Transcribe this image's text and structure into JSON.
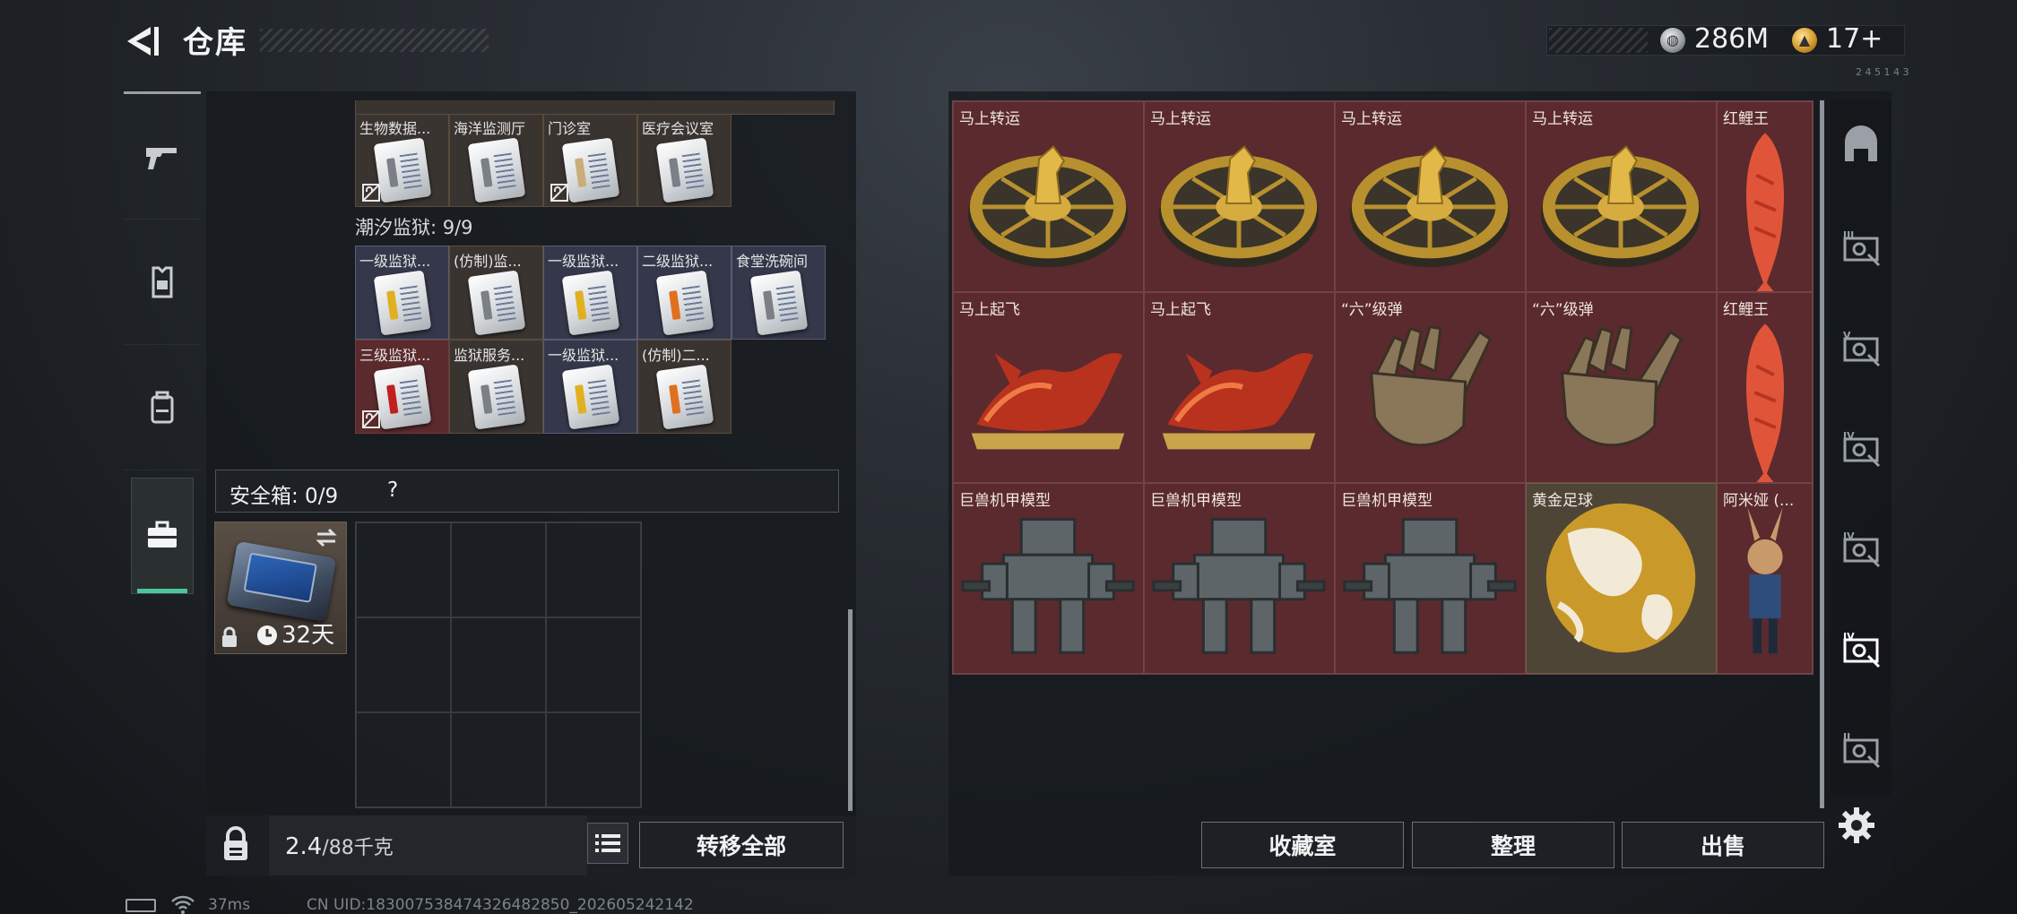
{
  "header": {
    "title": "仓库",
    "currencies": [
      {
        "icon": "silver-coin-icon",
        "value": "286M"
      },
      {
        "icon": "gold-coin-icon",
        "value": "17+"
      }
    ],
    "version_tag": "2 4 5 1 4 3"
  },
  "left_rail": [
    {
      "icon": "pistol-icon",
      "active": false
    },
    {
      "icon": "armor-vest-icon",
      "active": false
    },
    {
      "icon": "backpack-icon",
      "active": false
    },
    {
      "icon": "briefcase-icon",
      "active": true
    }
  ],
  "storage": {
    "row_top": [
      {
        "label": "生物数据...",
        "stripe": "#7b7f86",
        "locked": true
      },
      {
        "label": "海洋监测厅",
        "stripe": "#7b7f86",
        "locked": false
      },
      {
        "label": "门诊室",
        "stripe": "#c9ad7a",
        "locked": true
      },
      {
        "label": "医疗会议室",
        "stripe": "#7b7f86",
        "locked": false
      }
    ],
    "section_title": "潮汐监狱: 9/9",
    "section_cards": [
      {
        "label": "一级监狱...",
        "stripe": "#e0b020",
        "locked": false,
        "tone": "blue"
      },
      {
        "label": "(仿制)监...",
        "stripe": "#7b7f86",
        "locked": false,
        "tone": "brown"
      },
      {
        "label": "一级监狱...",
        "stripe": "#e0b020",
        "locked": false,
        "tone": "blue"
      },
      {
        "label": "二级监狱...",
        "stripe": "#e07020",
        "locked": false,
        "tone": "blue"
      },
      {
        "label": "食堂洗碗间",
        "stripe": "#7b7f86",
        "locked": false,
        "tone": "blue"
      },
      {
        "label": "三级监狱...",
        "stripe": "#c02020",
        "locked": true,
        "tone": "red"
      },
      {
        "label": "监狱服务...",
        "stripe": "#7b7f86",
        "locked": false,
        "tone": "brown"
      },
      {
        "label": "一级监狱...",
        "stripe": "#e0b020",
        "locked": false,
        "tone": "blue"
      },
      {
        "label": "(仿制)二...",
        "stripe": "#e07020",
        "locked": false,
        "tone": "brown"
      }
    ]
  },
  "safe_box": {
    "title": "安全箱: 0/9",
    "help": "?",
    "days": "32天"
  },
  "footer_left": {
    "weight": "2.4",
    "weight_unit": "/88千克",
    "transfer_all": "转移全部"
  },
  "items": [
    {
      "label": "马上转运",
      "kind": "compass",
      "tone": "red"
    },
    {
      "label": "马上转运",
      "kind": "compass",
      "tone": "red"
    },
    {
      "label": "马上转运",
      "kind": "compass",
      "tone": "red"
    },
    {
      "label": "马上转运",
      "kind": "compass",
      "tone": "red"
    },
    {
      "label": "红鲤王",
      "kind": "fish",
      "tone": "red"
    },
    {
      "label": "马上起飞",
      "kind": "horse",
      "tone": "red"
    },
    {
      "label": "马上起飞",
      "kind": "horse",
      "tone": "red"
    },
    {
      "label": "“六”级弹",
      "kind": "hand",
      "tone": "red"
    },
    {
      "label": "“六”级弹",
      "kind": "hand",
      "tone": "red"
    },
    {
      "label": "红鲤王",
      "kind": "fish",
      "tone": "red"
    },
    {
      "label": "巨兽机甲模型",
      "kind": "mech",
      "tone": "red"
    },
    {
      "label": "巨兽机甲模型",
      "kind": "mech",
      "tone": "red"
    },
    {
      "label": "巨兽机甲模型",
      "kind": "mech",
      "tone": "red"
    },
    {
      "label": "黄金足球",
      "kind": "ball",
      "tone": "gold"
    },
    {
      "label": "阿米娅 (...",
      "kind": "figure",
      "tone": "red"
    }
  ],
  "right_tabs": [
    {
      "icon": "container-icon",
      "selected": false
    },
    {
      "icon": "case-iii-icon",
      "selected": false
    },
    {
      "icon": "case-v-icon",
      "selected": false
    },
    {
      "icon": "case-iv-icon",
      "selected": false
    },
    {
      "icon": "case-iv-b-icon",
      "selected": false
    },
    {
      "icon": "case-iv-c-icon",
      "selected": true
    },
    {
      "icon": "case-ii-icon",
      "selected": false
    }
  ],
  "footer_right": {
    "collection": "收藏室",
    "sort": "整理",
    "sell": "出售"
  },
  "status": {
    "ping": "37ms",
    "uid": "CN UID:183007538474326482850_202605242142"
  }
}
